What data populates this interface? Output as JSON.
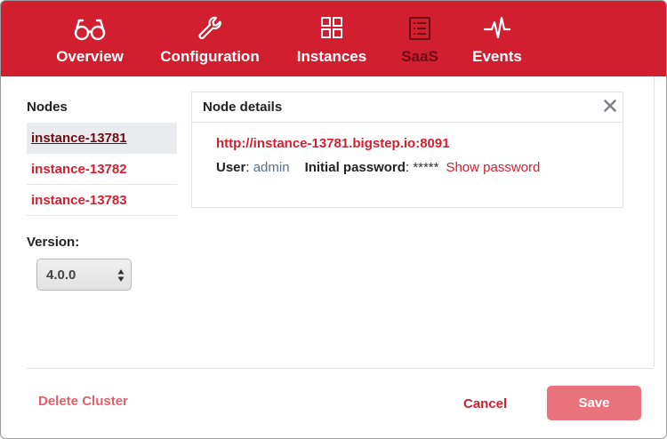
{
  "nav": {
    "items": [
      {
        "label": "Overview",
        "icon": "glasses-icon"
      },
      {
        "label": "Configuration",
        "icon": "wrench-icon"
      },
      {
        "label": "Instances",
        "icon": "grid-icon"
      },
      {
        "label": "SaaS",
        "icon": "list-icon",
        "active": true
      },
      {
        "label": "Events",
        "icon": "pulse-icon"
      }
    ]
  },
  "sidebar": {
    "title": "Nodes",
    "nodes": [
      {
        "label": "instance-13781",
        "selected": true
      },
      {
        "label": "instance-13782"
      },
      {
        "label": "instance-13783"
      }
    ],
    "version_label": "Version:",
    "version_value": "4.0.0"
  },
  "details": {
    "title": "Node details",
    "url": "http://instance-13781.bigstep.io:8091",
    "user_label": "User",
    "user_sep": ": ",
    "user_value": "admin",
    "password_label": "Initial password",
    "password_sep": ": ",
    "password_value": "*****",
    "show_password": "Show password"
  },
  "footer": {
    "delete": "Delete Cluster",
    "cancel": "Cancel",
    "save": "Save"
  },
  "colors": {
    "brand_red": "#d11f2f",
    "active_nav": "#6e0c14",
    "save_button": "#e8737d"
  }
}
